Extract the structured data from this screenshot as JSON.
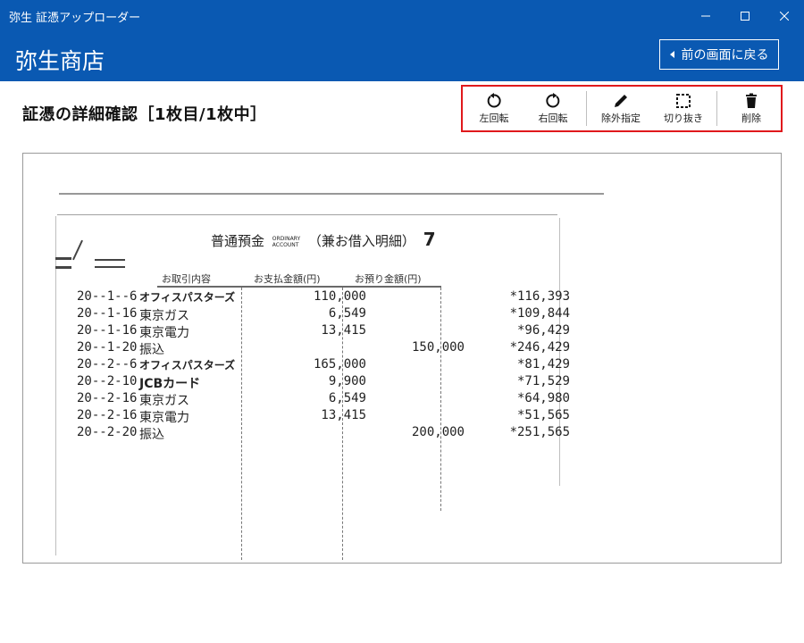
{
  "window": {
    "title": "弥生 証憑アップローダー"
  },
  "header": {
    "store_name": "弥生商店",
    "back_label": "前の画面に戻る"
  },
  "page": {
    "title": "証憑の詳細確認［1枚目/1枚中］"
  },
  "toolbar": {
    "rotate_left": "左回転",
    "rotate_right": "右回転",
    "exclude": "除外指定",
    "crop": "切り抜き",
    "delete": "削除"
  },
  "statement": {
    "title": "普通預金",
    "title_en_1": "ORDINARY",
    "title_en_2": "ACCOUNT",
    "subtitle": "（兼お借入明細）",
    "page_no": "7",
    "columns": {
      "description": "お取引内容",
      "payment": "お支払金額(円)",
      "deposit": "お預り金額(円)"
    },
    "rows": [
      {
        "date": "20--1--6",
        "desc": "オフィスパスターズ",
        "payment": "110,000",
        "deposit": "",
        "balance": "*116,393"
      },
      {
        "date": "20--1-16",
        "desc": "東京ガス",
        "payment": "6,549",
        "deposit": "",
        "balance": "*109,844"
      },
      {
        "date": "20--1-16",
        "desc": "東京電力",
        "payment": "13,415",
        "deposit": "",
        "balance": "*96,429"
      },
      {
        "date": "20--1-20",
        "desc": "振込",
        "payment": "",
        "deposit": "150,000",
        "balance": "*246,429"
      },
      {
        "date": "20--2--6",
        "desc": "オフィスパスターズ",
        "payment": "165,000",
        "deposit": "",
        "balance": "*81,429"
      },
      {
        "date": "20--2-10",
        "desc": "JCBカード",
        "payment": "9,900",
        "deposit": "",
        "balance": "*71,529"
      },
      {
        "date": "20--2-16",
        "desc": "東京ガス",
        "payment": "6,549",
        "deposit": "",
        "balance": "*64,980"
      },
      {
        "date": "20--2-16",
        "desc": "東京電力",
        "payment": "13,415",
        "deposit": "",
        "balance": "*51,565"
      },
      {
        "date": "20--2-20",
        "desc": "振込",
        "payment": "",
        "deposit": "200,000",
        "balance": "*251,565"
      }
    ]
  }
}
